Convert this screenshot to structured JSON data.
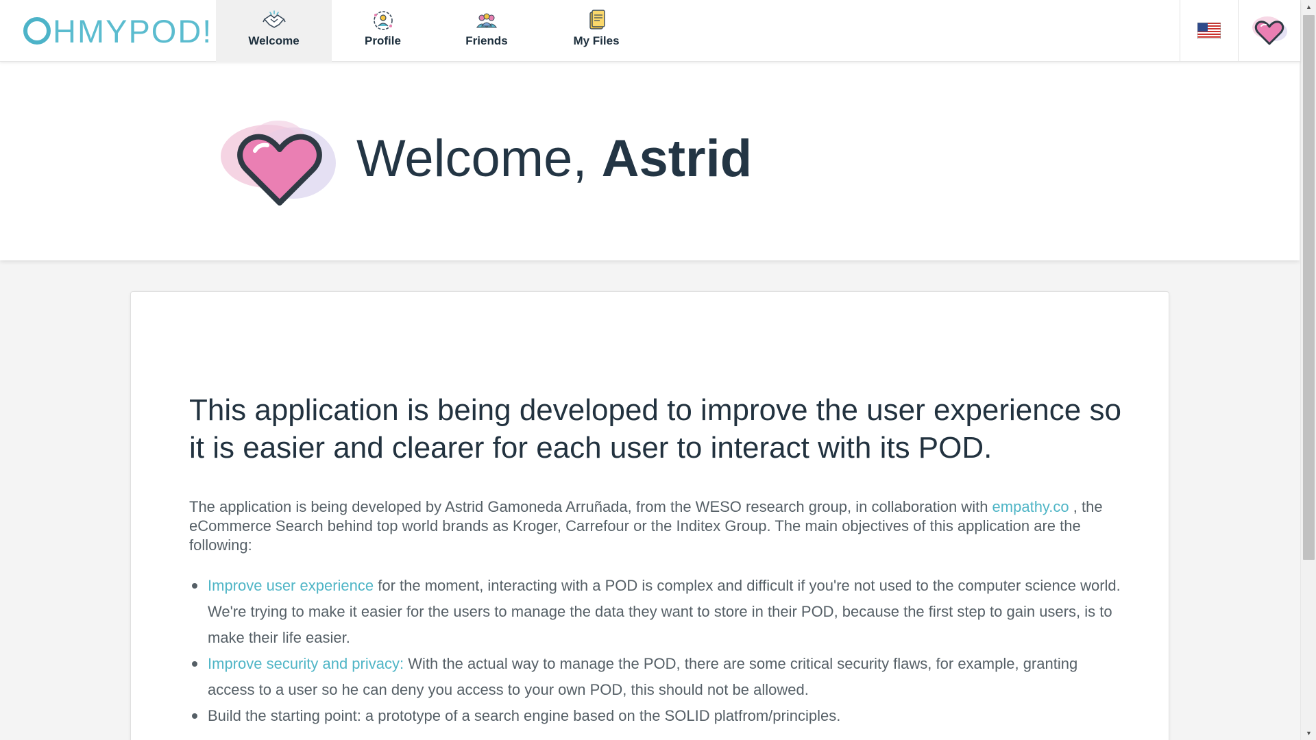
{
  "app": {
    "brand": "HMYPOD!"
  },
  "nav": {
    "tabs": [
      {
        "label": "Welcome",
        "icon": "handshake-icon",
        "active": true
      },
      {
        "label": "Profile",
        "icon": "profile-icon",
        "active": false
      },
      {
        "label": "Friends",
        "icon": "friends-icon",
        "active": false
      },
      {
        "label": "My Files",
        "icon": "files-icon",
        "active": false
      }
    ],
    "language_icon": "us-flag-icon",
    "user_icon": "heart-avatar-icon"
  },
  "welcome": {
    "greeting": "Welcome, ",
    "user_name": "Astrid"
  },
  "card": {
    "lead": "This application is being developed to improve the user experience so it is easier and clearer for each user to interact with its POD.",
    "intro_before_link": "The application is being developed by Astrid Gamoneda Arruñada, from the WESO research group, in collaboration with ",
    "intro_link": "empathy.co",
    "intro_after_link": " , the eCommerce Search behind top world brands as Kroger, Carrefour or the Inditex Group. The main objectives of this application are the following:",
    "objectives": [
      {
        "highlight": "Improve user experience",
        "text": " for the moment, interacting with a POD is complex and difficult if you're not used to the computer science world. We're trying to make it easier for the users to manage the data they want to store in their POD, because the first step to gain users, is to make their life easier."
      },
      {
        "highlight": "Improve security and privacy:",
        "text": " With the actual way to manage the POD, there are some critical security flaws, for example, granting access to a user so he can deny you access to your own POD, this should not be allowed."
      },
      {
        "highlight": "",
        "text": "Build the starting point: a prototype of a search engine based on the SOLID platfrom/principles."
      }
    ]
  },
  "colors": {
    "accent": "#4fb5c6",
    "heading": "#233544",
    "body_text": "#555f66",
    "heart_pink": "#ea7fb3"
  }
}
